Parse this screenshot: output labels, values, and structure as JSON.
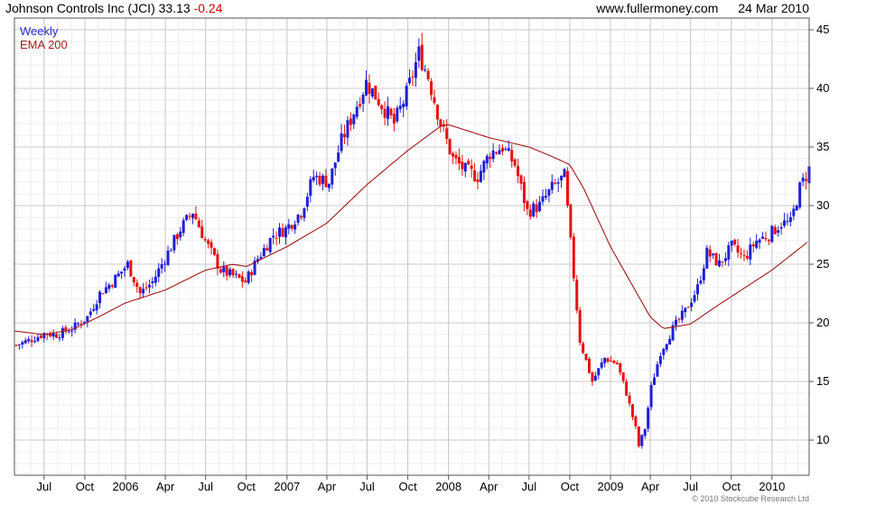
{
  "header": {
    "name": "Johnson Controls Inc (JCI)",
    "last": "33.13",
    "change": "-0.24",
    "site": "www.fullermoney.com",
    "date": "24 Mar 2010"
  },
  "legend": {
    "line1": "Weekly",
    "line2": "EMA 200"
  },
  "footer": {
    "copyright": "© 2010 Stockcube Research Ltd"
  },
  "colors": {
    "up": "#1f1fd6",
    "down": "#e81010",
    "ema": "#a01818",
    "grid": "#d8d8d8"
  },
  "chart_data": {
    "type": "candlestick",
    "title": "Johnson Controls Inc (JCI)",
    "ylim": [
      7,
      46
    ],
    "yticks": [
      10,
      15,
      20,
      25,
      30,
      35,
      40,
      45
    ],
    "y_axis_position": "right",
    "grid": true,
    "legend_position": "top-left",
    "x_range": [
      "2005-04-25",
      "2010-03-26"
    ],
    "x_ticks": [
      {
        "date": "2005-07-01",
        "label": "Jul"
      },
      {
        "date": "2005-10-01",
        "label": "Oct"
      },
      {
        "date": "2006-01-01",
        "label": "2006"
      },
      {
        "date": "2006-04-01",
        "label": "Apr"
      },
      {
        "date": "2006-07-01",
        "label": "Jul"
      },
      {
        "date": "2006-10-01",
        "label": "Oct"
      },
      {
        "date": "2007-01-01",
        "label": "2007"
      },
      {
        "date": "2007-04-01",
        "label": "Apr"
      },
      {
        "date": "2007-07-01",
        "label": "Jul"
      },
      {
        "date": "2007-10-01",
        "label": "Oct"
      },
      {
        "date": "2008-01-01",
        "label": "2008"
      },
      {
        "date": "2008-04-01",
        "label": "Apr"
      },
      {
        "date": "2008-07-01",
        "label": "Jul"
      },
      {
        "date": "2008-10-01",
        "label": "Oct"
      },
      {
        "date": "2009-01-01",
        "label": "2009"
      },
      {
        "date": "2009-04-01",
        "label": "Apr"
      },
      {
        "date": "2009-07-01",
        "label": "Jul"
      },
      {
        "date": "2009-10-01",
        "label": "Oct"
      },
      {
        "date": "2010-01-01",
        "label": "2010"
      }
    ],
    "price_series": {
      "name": "Weekly",
      "points": [
        [
          "2005-04-29",
          18.1
        ],
        [
          "2005-06-03",
          18.6
        ],
        [
          "2005-07-01",
          19.1
        ],
        [
          "2005-07-29",
          19.0
        ],
        [
          "2005-09-02",
          19.5
        ],
        [
          "2005-10-07",
          20.5
        ],
        [
          "2005-11-04",
          22.5
        ],
        [
          "2005-12-02",
          23.5
        ],
        [
          "2006-01-06",
          25.0
        ],
        [
          "2006-02-03",
          22.5
        ],
        [
          "2006-03-03",
          23.5
        ],
        [
          "2006-04-07",
          26.0
        ],
        [
          "2006-05-05",
          28.0
        ],
        [
          "2006-06-02",
          29.5
        ],
        [
          "2006-06-30",
          27.0
        ],
        [
          "2006-08-04",
          24.5
        ],
        [
          "2006-09-01",
          24.0
        ],
        [
          "2006-09-29",
          23.5
        ],
        [
          "2006-10-27",
          25.5
        ],
        [
          "2006-12-01",
          27.5
        ],
        [
          "2006-12-29",
          28.0
        ],
        [
          "2007-02-02",
          29.5
        ],
        [
          "2007-03-02",
          32.5
        ],
        [
          "2007-04-06",
          32.0
        ],
        [
          "2007-05-04",
          35.5
        ],
        [
          "2007-06-01",
          38.0
        ],
        [
          "2007-06-29",
          40.5
        ],
        [
          "2007-07-27",
          39.0
        ],
        [
          "2007-08-31",
          37.0
        ],
        [
          "2007-09-28",
          39.5
        ],
        [
          "2007-10-26",
          43.0
        ],
        [
          "2007-11-16",
          41.0
        ],
        [
          "2007-12-14",
          37.0
        ],
        [
          "2008-01-11",
          34.0
        ],
        [
          "2008-02-08",
          33.0
        ],
        [
          "2008-03-07",
          32.5
        ],
        [
          "2008-04-04",
          34.5
        ],
        [
          "2008-05-02",
          35.0
        ],
        [
          "2008-05-30",
          33.5
        ],
        [
          "2008-06-27",
          29.5
        ],
        [
          "2008-07-25",
          30.0
        ],
        [
          "2008-08-22",
          31.5
        ],
        [
          "2008-09-19",
          32.5
        ],
        [
          "2008-10-10",
          24.0
        ],
        [
          "2008-10-24",
          18.5
        ],
        [
          "2008-11-21",
          15.0
        ],
        [
          "2008-12-19",
          17.0
        ],
        [
          "2009-01-16",
          16.5
        ],
        [
          "2009-02-06",
          14.0
        ],
        [
          "2009-02-27",
          11.0
        ],
        [
          "2009-03-06",
          9.5
        ],
        [
          "2009-03-20",
          11.0
        ],
        [
          "2009-04-03",
          14.5
        ],
        [
          "2009-04-24",
          17.5
        ],
        [
          "2009-05-22",
          19.5
        ],
        [
          "2009-06-19",
          21.0
        ],
        [
          "2009-07-17",
          23.0
        ],
        [
          "2009-08-07",
          26.0
        ],
        [
          "2009-09-04",
          25.0
        ],
        [
          "2009-10-02",
          26.5
        ],
        [
          "2009-10-30",
          25.5
        ],
        [
          "2009-11-27",
          27.0
        ],
        [
          "2009-12-25",
          27.5
        ],
        [
          "2010-01-22",
          28.5
        ],
        [
          "2010-02-12",
          28.5
        ],
        [
          "2010-03-05",
          31.5
        ],
        [
          "2010-03-26",
          33.13
        ]
      ]
    },
    "ema_series": {
      "name": "EMA 200",
      "points": [
        [
          "2005-04-25",
          19.3
        ],
        [
          "2005-07-01",
          19.0
        ],
        [
          "2005-09-01",
          19.4
        ],
        [
          "2005-11-01",
          20.5
        ],
        [
          "2006-01-01",
          21.7
        ],
        [
          "2006-04-01",
          22.8
        ],
        [
          "2006-07-01",
          24.5
        ],
        [
          "2006-09-01",
          25.0
        ],
        [
          "2006-10-01",
          24.8
        ],
        [
          "2007-01-01",
          26.5
        ],
        [
          "2007-04-01",
          28.5
        ],
        [
          "2007-07-01",
          31.8
        ],
        [
          "2007-10-01",
          34.7
        ],
        [
          "2007-12-15",
          36.8
        ],
        [
          "2008-01-01",
          36.9
        ],
        [
          "2008-04-01",
          35.8
        ],
        [
          "2008-07-01",
          35.0
        ],
        [
          "2008-08-15",
          34.3
        ],
        [
          "2008-10-01",
          33.5
        ],
        [
          "2008-11-01",
          31.5
        ],
        [
          "2009-01-01",
          26.5
        ],
        [
          "2009-02-15",
          23.5
        ],
        [
          "2009-04-01",
          20.5
        ],
        [
          "2009-05-01",
          19.5
        ],
        [
          "2009-07-01",
          19.9
        ],
        [
          "2009-09-01",
          21.5
        ],
        [
          "2009-11-01",
          23.0
        ],
        [
          "2010-01-01",
          24.5
        ],
        [
          "2010-03-26",
          27.0
        ]
      ]
    }
  }
}
